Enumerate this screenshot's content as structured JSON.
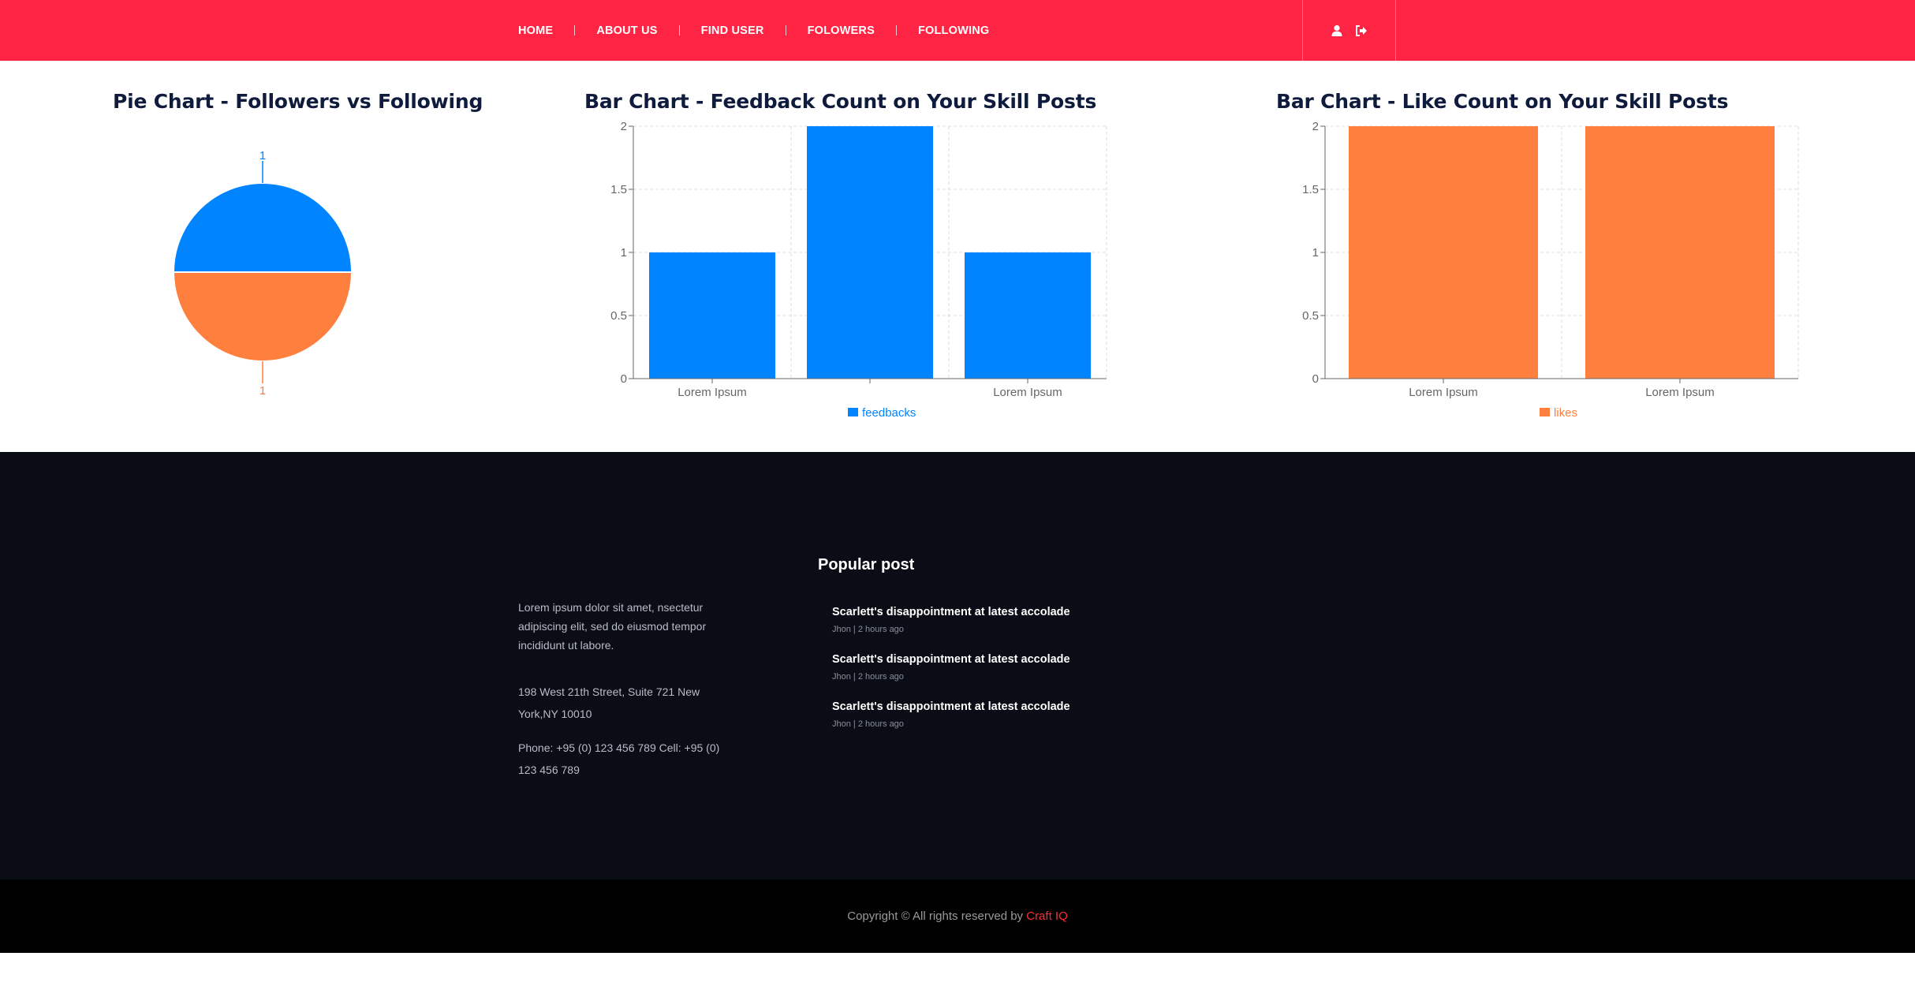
{
  "nav": {
    "items": [
      {
        "label": "HOME",
        "name": "nav-home"
      },
      {
        "label": "ABOUT US",
        "name": "nav-about-us"
      },
      {
        "label": "FIND USER",
        "name": "nav-find-user"
      },
      {
        "label": "FOLOWERS",
        "name": "nav-followers"
      },
      {
        "label": "FOLLOWING",
        "name": "nav-following"
      }
    ],
    "icons": [
      "user-icon",
      "sign-out-icon"
    ]
  },
  "colors": {
    "brand": "#ff2444",
    "blue": "#0084ff",
    "orange": "#ff7f3f",
    "footer_bg": "#0a0d16",
    "title": "#0f1b3d"
  },
  "chart_data": [
    {
      "type": "pie",
      "title": "Pie Chart - Followers vs Following",
      "values": [
        1,
        1
      ],
      "data_labels": [
        "1",
        "1"
      ],
      "colors": [
        "#0084ff",
        "#ff7f3f"
      ]
    },
    {
      "type": "bar",
      "title": "Bar Chart - Feedback Count on Your Skill Posts",
      "categories": [
        "Lorem Ipsum",
        "",
        "Lorem Ipsum"
      ],
      "series": [
        {
          "name": "feedbacks",
          "values": [
            1,
            2,
            1
          ],
          "color": "#0084ff"
        }
      ],
      "ylim": [
        0,
        2
      ],
      "yticks": [
        "0",
        "0.5",
        "1",
        "1.5",
        "2"
      ],
      "grid": true,
      "legend": "bottom"
    },
    {
      "type": "bar",
      "title": "Bar Chart - Like Count on Your Skill Posts",
      "categories": [
        "Lorem Ipsum",
        "Lorem Ipsum"
      ],
      "series": [
        {
          "name": "likes",
          "values": [
            2,
            2
          ],
          "color": "#ff7f3f"
        }
      ],
      "ylim": [
        0,
        2
      ],
      "yticks": [
        "0",
        "0.5",
        "1",
        "1.5",
        "2"
      ],
      "grid": true,
      "legend": "bottom"
    }
  ],
  "footer": {
    "about": "Lorem ipsum dolor sit amet, nsectetur adipiscing elit, sed do eiusmod tempor incididunt ut labore.",
    "address": "198 West 21th Street, Suite 721 New York,NY 10010",
    "phone": "Phone: +95 (0) 123 456 789 Cell: +95 (0) 123 456 789",
    "popular_title": "Popular post",
    "posts": [
      {
        "title": "Scarlett's disappointment at latest accolade",
        "meta": "Jhon | 2 hours ago"
      },
      {
        "title": "Scarlett's disappointment at latest accolade",
        "meta": "Jhon | 2 hours ago"
      },
      {
        "title": "Scarlett's disappointment at latest accolade",
        "meta": "Jhon | 2 hours ago"
      }
    ]
  },
  "copyright": {
    "text": "Copyright © All rights reserved by ",
    "brand": "Craft IQ"
  }
}
